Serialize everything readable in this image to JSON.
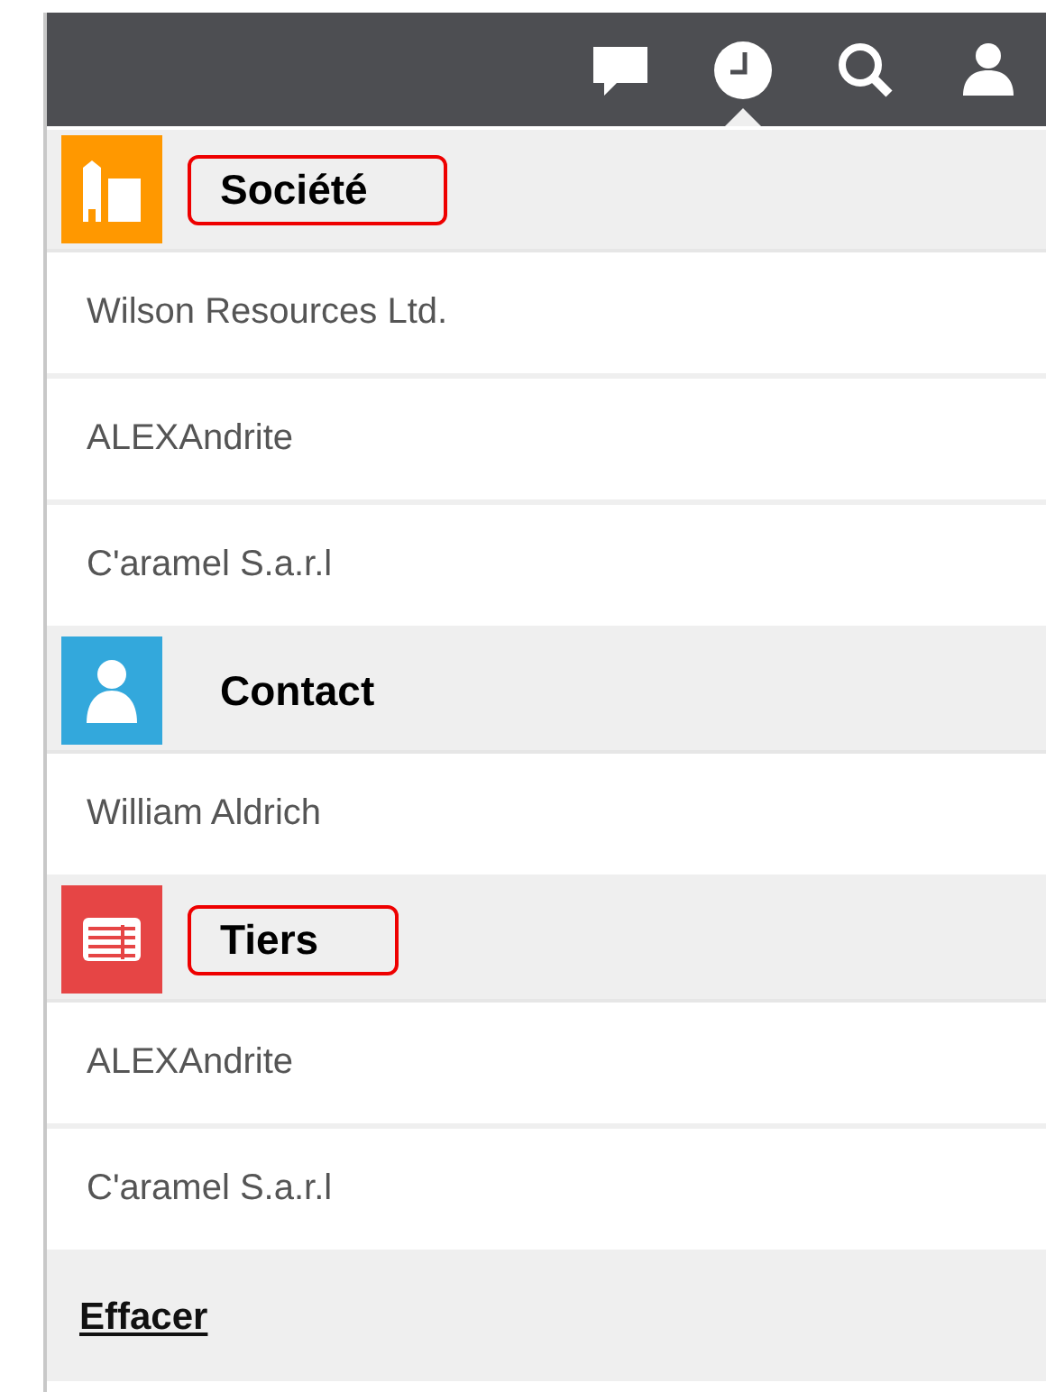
{
  "toolbar": {
    "items": [
      {
        "kind": "chat",
        "selected": false
      },
      {
        "kind": "clock",
        "selected": true
      },
      {
        "kind": "search",
        "selected": false
      },
      {
        "kind": "user",
        "selected": false
      }
    ]
  },
  "sections": [
    {
      "kind": "building",
      "title": "Société",
      "color": "#ff9800",
      "highlighted": true,
      "items": [
        "Wilson Resources Ltd.",
        "ALEXAndrite",
        "C'aramel S.a.r.l"
      ]
    },
    {
      "kind": "person",
      "title": "Contact",
      "color": "#33a8dc",
      "highlighted": false,
      "items": [
        "William Aldrich"
      ]
    },
    {
      "kind": "table",
      "title": "Tiers",
      "color": "#e64545",
      "highlighted": true,
      "items": [
        "ALEXAndrite",
        "C'aramel S.a.r.l"
      ]
    }
  ],
  "clear_link": "Effacer"
}
